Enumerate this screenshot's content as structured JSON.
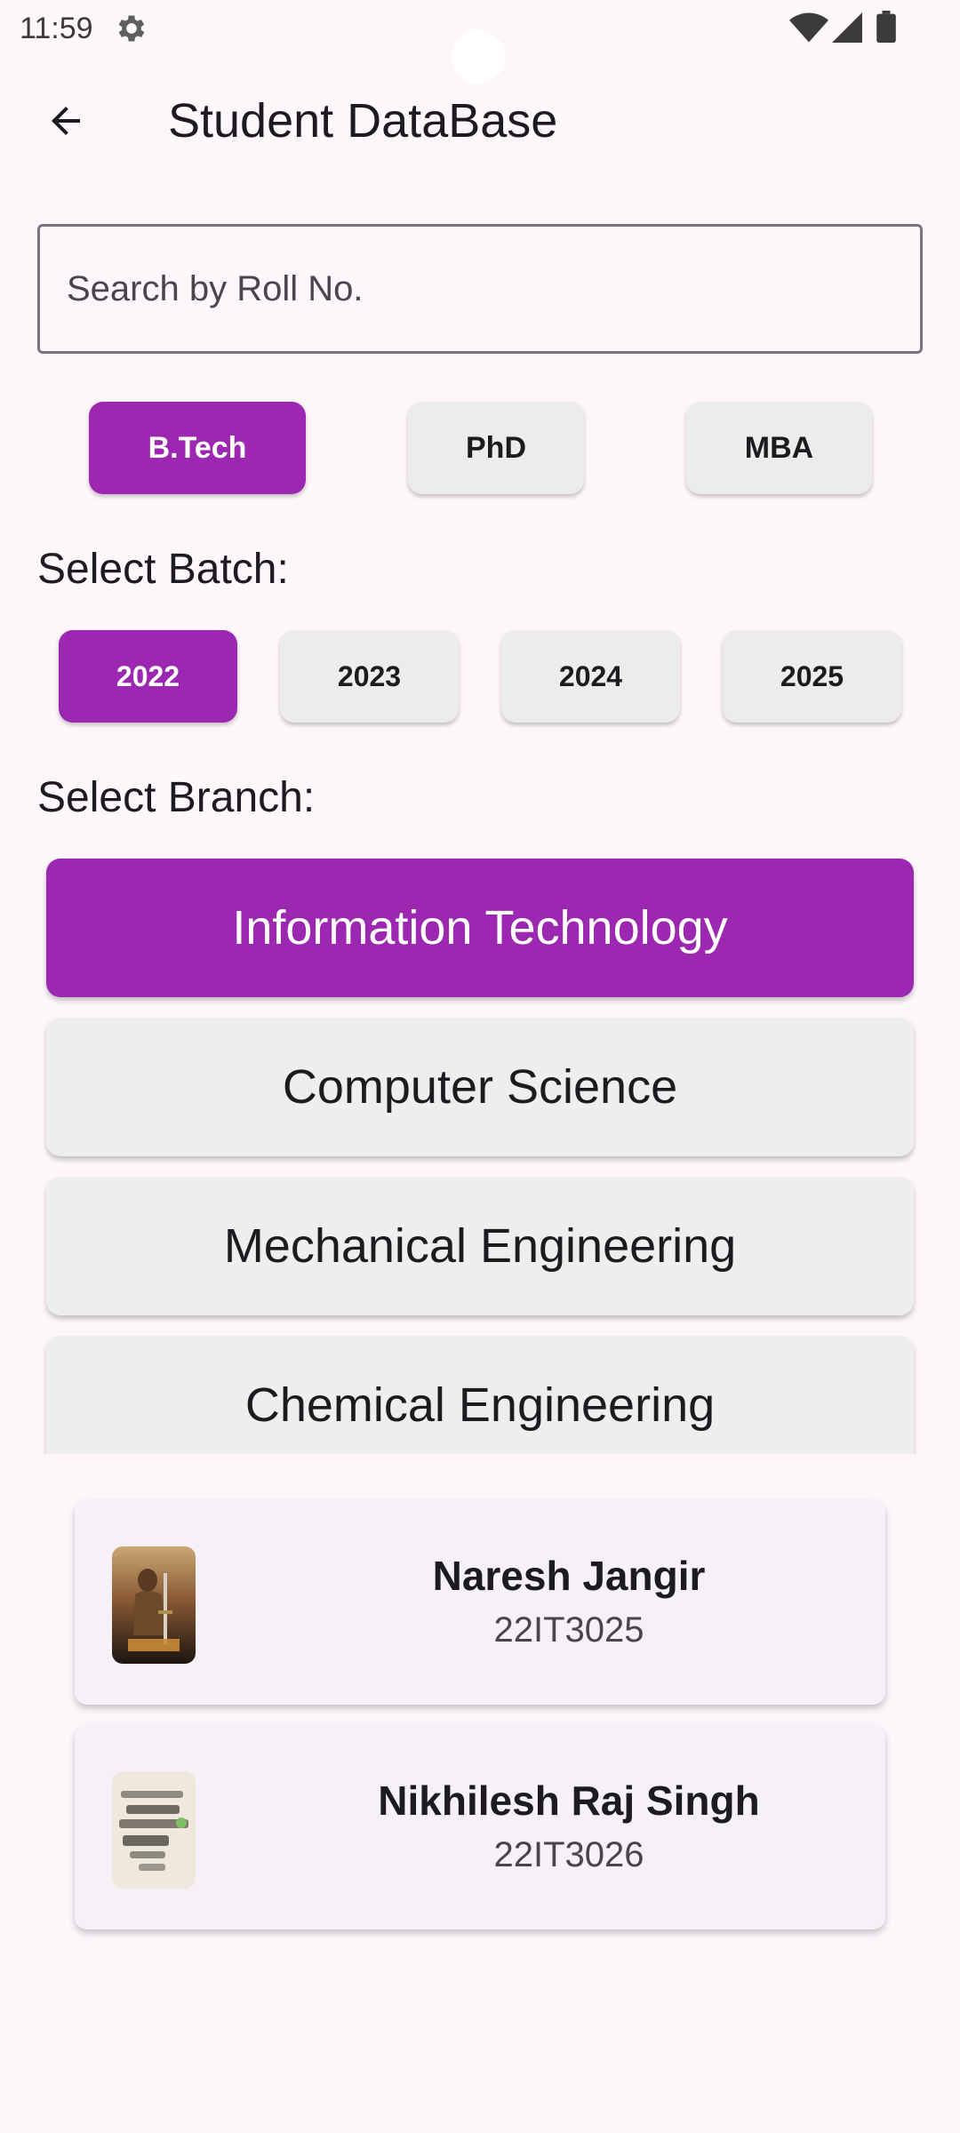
{
  "status_bar": {
    "time": "11:59"
  },
  "app_bar": {
    "title": "Student DataBase"
  },
  "search": {
    "placeholder": "Search by Roll No.",
    "value": ""
  },
  "programs": [
    {
      "label": "B.Tech",
      "selected": true
    },
    {
      "label": "PhD",
      "selected": false
    },
    {
      "label": "MBA",
      "selected": false
    }
  ],
  "batch_section": {
    "label": "Select Batch:"
  },
  "batches": [
    {
      "label": "2022",
      "selected": true
    },
    {
      "label": "2023",
      "selected": false
    },
    {
      "label": "2024",
      "selected": false
    },
    {
      "label": "2025",
      "selected": false
    }
  ],
  "branch_section": {
    "label": "Select Branch:"
  },
  "branches": [
    {
      "label": "Information Technology",
      "selected": true
    },
    {
      "label": "Computer Science",
      "selected": false
    },
    {
      "label": "Mechanical Engineering",
      "selected": false
    },
    {
      "label": "Chemical Engineering",
      "selected": false
    }
  ],
  "students": [
    {
      "name": "Naresh Jangir",
      "roll": "22IT3025"
    },
    {
      "name": "Nikhilesh Raj Singh",
      "roll": "22IT3026"
    }
  ],
  "colors": {
    "accent": "#9c27b0",
    "background": "#fdf6fb",
    "chip": "#ececec"
  }
}
